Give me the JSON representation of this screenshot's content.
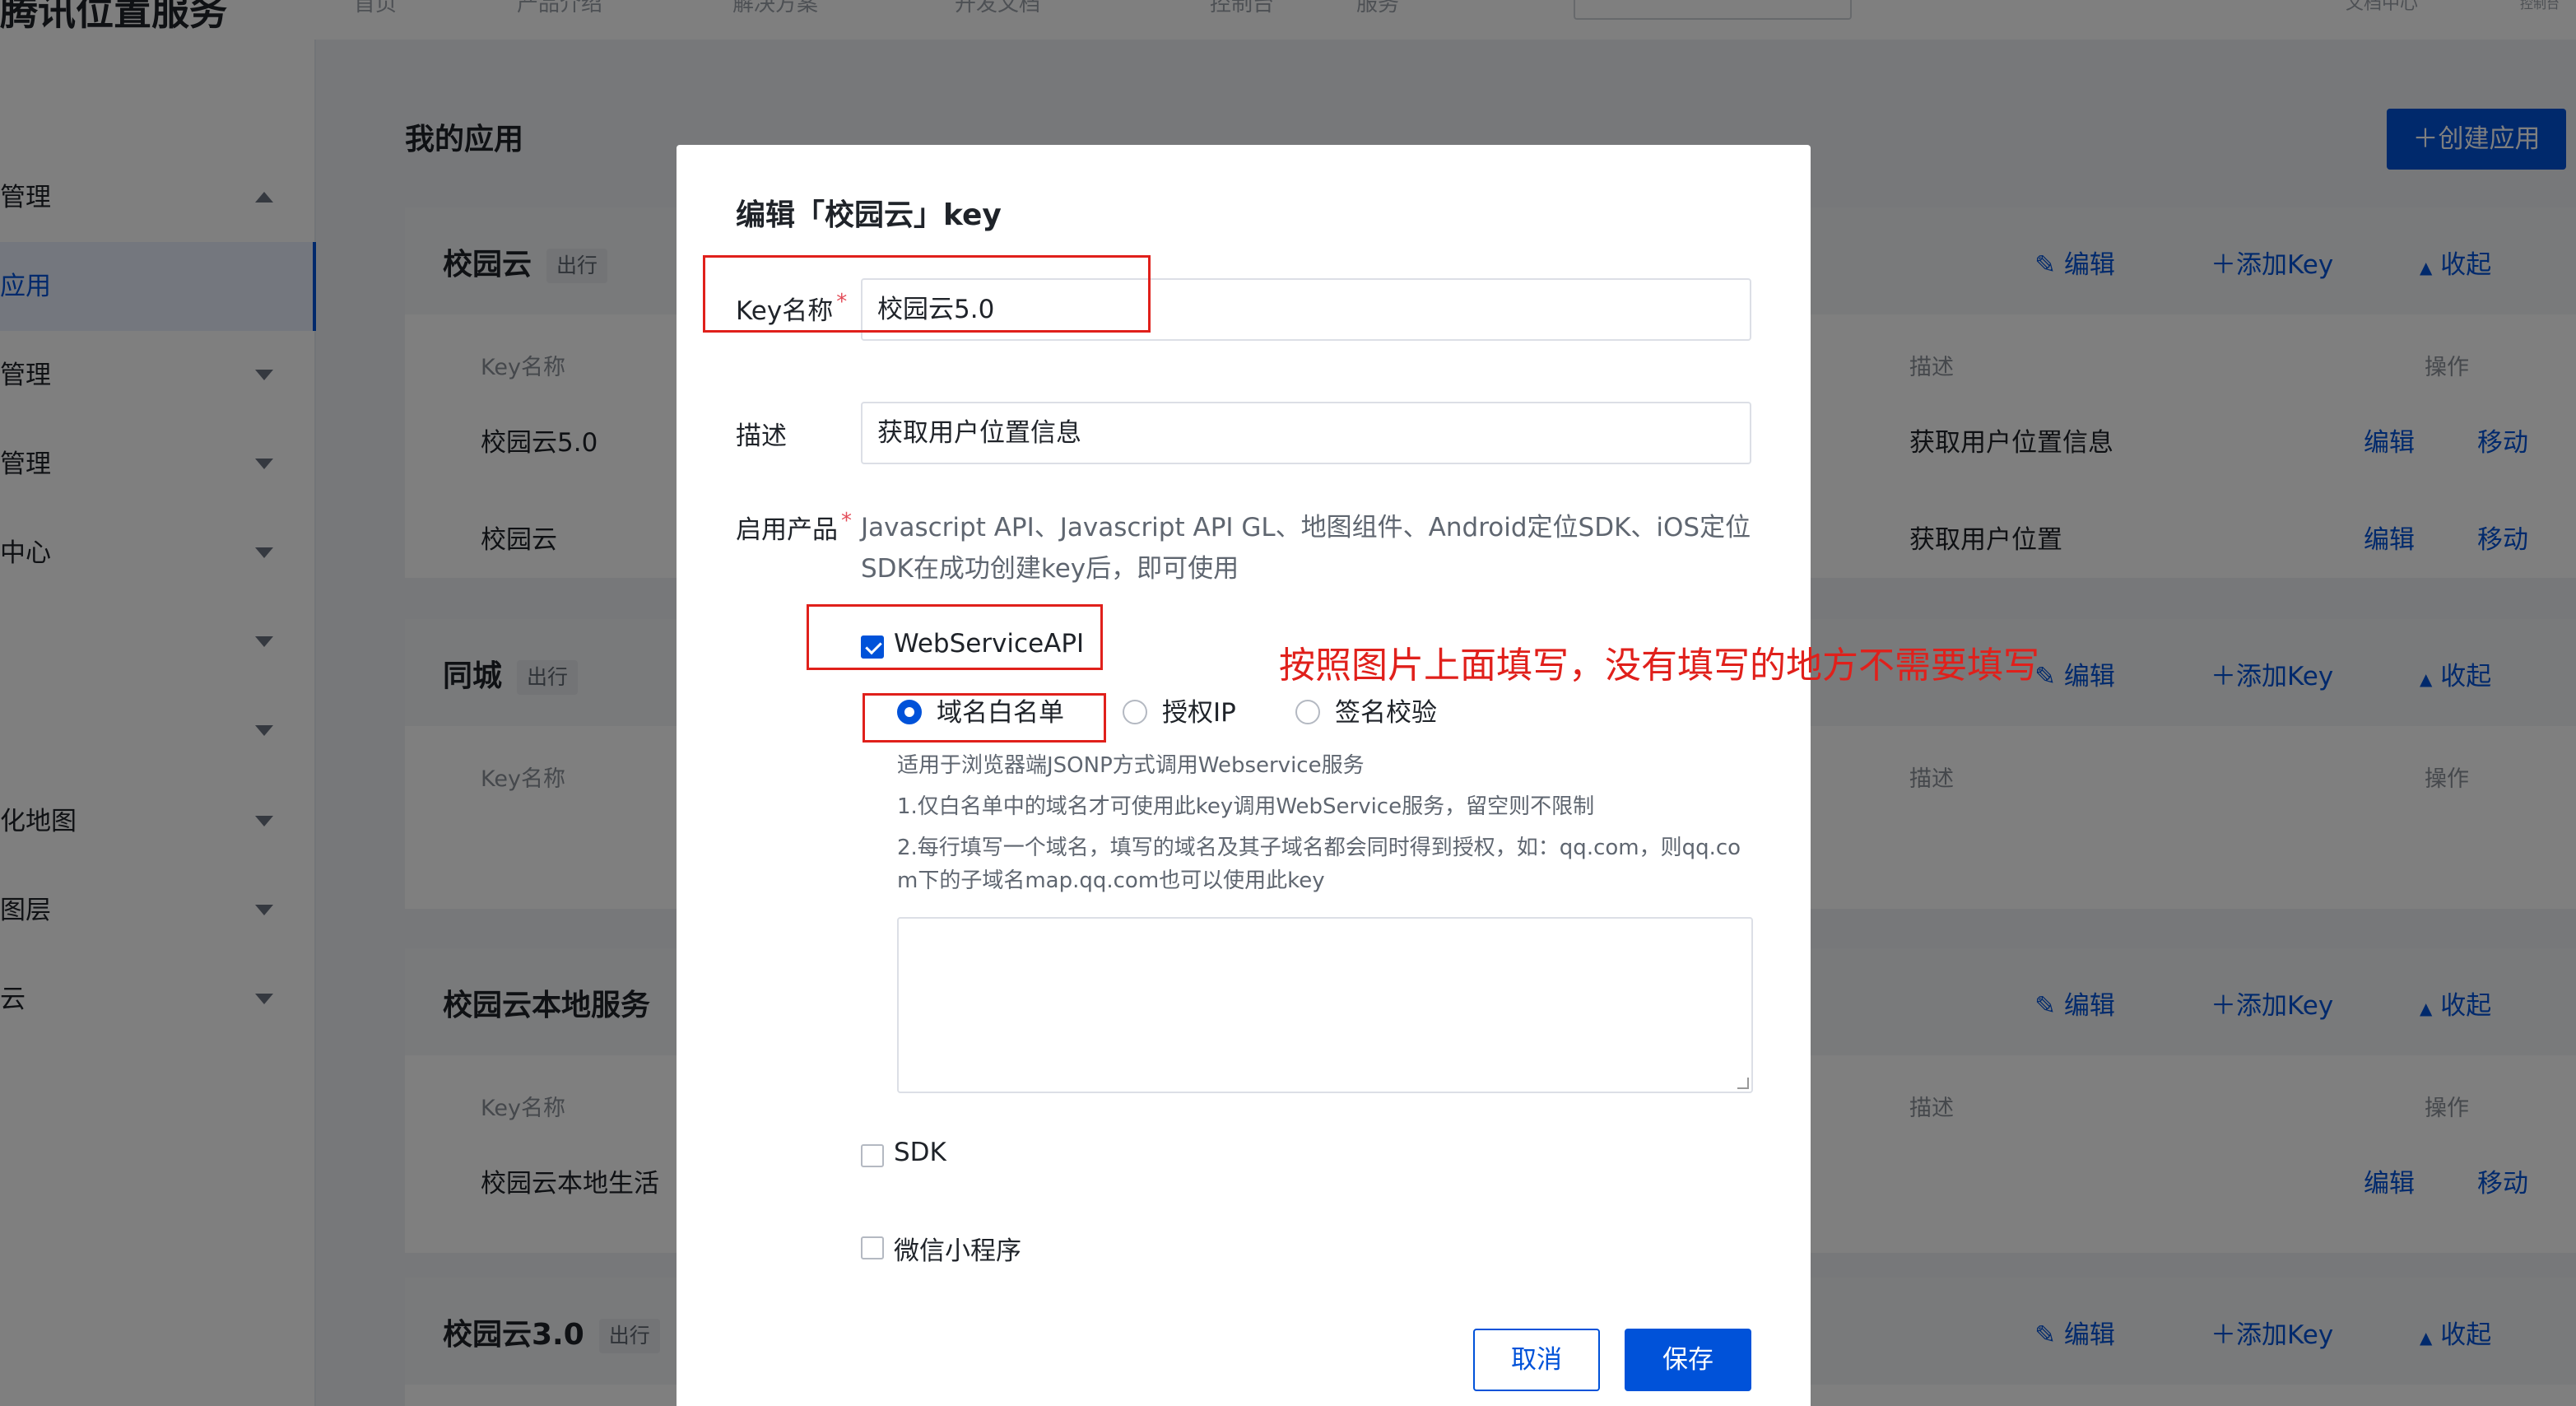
{
  "header": {
    "logo": "腾讯位置服务",
    "nav": [
      "首页",
      "产品介绍",
      "解决方案",
      "开发文档",
      "控制台",
      "服务"
    ],
    "right": [
      "文档中心",
      "控制台"
    ]
  },
  "sidebar": {
    "items": [
      {
        "label": "管理",
        "arrow": "up"
      },
      {
        "label": "应用",
        "arrow": ""
      },
      {
        "label": "管理",
        "arrow": "down"
      },
      {
        "label": "管理",
        "arrow": "down"
      },
      {
        "label": "中心",
        "arrow": "down"
      },
      {
        "label": "",
        "arrow": "down"
      },
      {
        "label": "",
        "arrow": "down"
      },
      {
        "label": "化地图",
        "arrow": "down"
      },
      {
        "label": "图层",
        "arrow": "down"
      },
      {
        "label": "云",
        "arrow": "down"
      }
    ]
  },
  "main": {
    "title": "我的应用",
    "create_button": "＋创建应用",
    "actions": {
      "edit": "编辑",
      "add_key": "添加Key",
      "collapse": "收起"
    },
    "columns": {
      "key_name": "Key名称",
      "desc": "描述",
      "ops": "操作"
    },
    "row_actions": {
      "edit": "编辑",
      "move": "移动"
    },
    "apps": [
      {
        "name": "校园云",
        "badge": "出行",
        "rows": [
          {
            "key": "校园云5.0",
            "desc": "获取用户位置信息"
          },
          {
            "key": "校园云",
            "desc": "获取用户位置"
          }
        ]
      },
      {
        "name": "同城",
        "badge": "出行",
        "rows": []
      },
      {
        "name": "校园云本地服务",
        "badge": "",
        "rows": [
          {
            "key": "校园云本地生活",
            "desc": ""
          }
        ]
      },
      {
        "name": "校园云3.0",
        "badge": "出行",
        "rows": []
      }
    ]
  },
  "modal": {
    "title": "编辑「校园云」key",
    "key_name_label": "Key名称",
    "key_name_value": "校园云5.0",
    "desc_label": "描述",
    "desc_value": "获取用户位置信息",
    "products_label": "启用产品",
    "products_text": "Javascript API、Javascript API GL、地图组件、Android定位SDK、iOS定位SDK在成功创建key后，即可使用",
    "webservice_label": "WebServiceAPI",
    "webservice_checked": true,
    "radio_options": [
      "域名白名单",
      "授权IP",
      "签名校验"
    ],
    "radio_selected": "域名白名单",
    "hint_1": "适用于浏览器端JSONP方式调用Webservice服务",
    "hint_2": "1.仅白名单中的域名才可使用此key调用WebService服务，留空则不限制",
    "hint_3": "2.每行填写一个域名，填写的域名及其子域名都会同时得到授权，如：qq.com，则qq.com下的子域名map.qq.com也可以使用此key",
    "whitelist_value": "",
    "sdk_label": "SDK",
    "sdk_checked": false,
    "miniprogram_label": "微信小程序",
    "miniprogram_checked": false,
    "cancel": "取消",
    "save": "保存"
  },
  "annotation": {
    "text": "按照图片上面填写，没有填写的地方不需要填写",
    "color": "#e0201b"
  },
  "colors": {
    "accent": "#0052d9",
    "required": "#e34d59"
  }
}
